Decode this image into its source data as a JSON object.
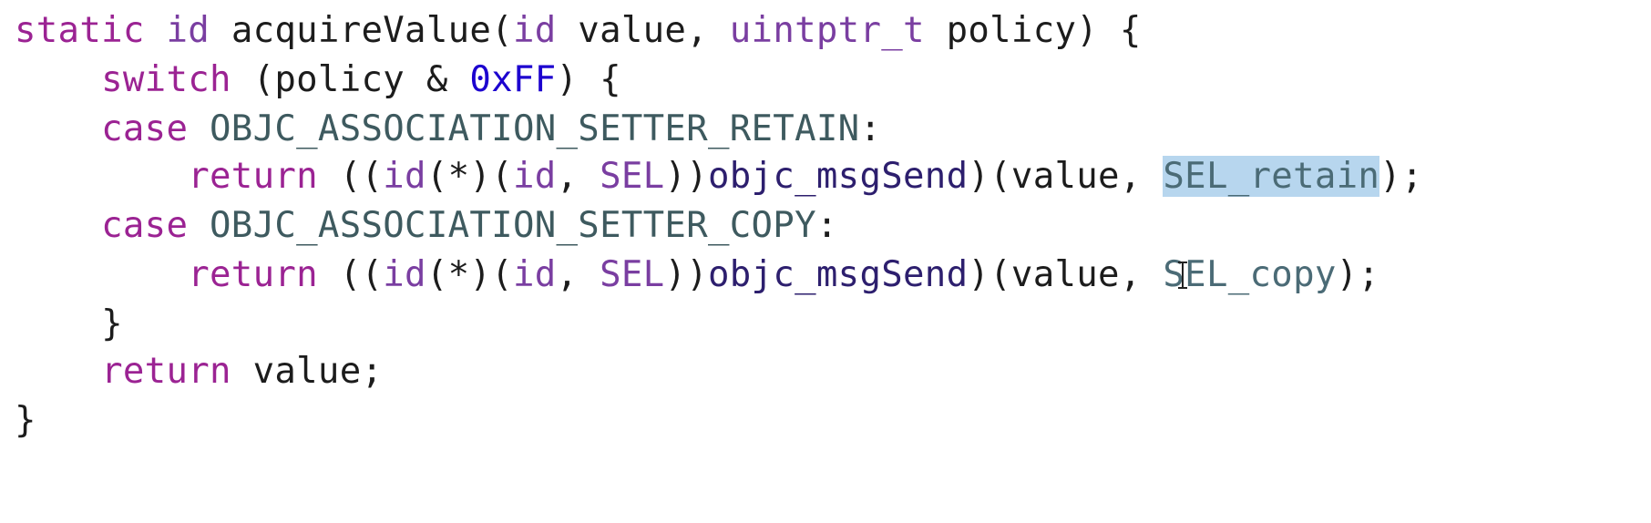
{
  "code": {
    "line1": {
      "kw_static": "static",
      "t_id": "id",
      "name": "acquireValue(",
      "t_id2": "id",
      "p1": "value,",
      "t_uintptr": "uintptr_t",
      "p2": "policy) {"
    },
    "line2": {
      "kw_switch": "switch",
      "open": "(policy &",
      "hex": "0xFF",
      "close": ") {"
    },
    "line3": {
      "kw_case": "case",
      "macro": "OBJC_ASSOCIATION_SETTER_RETAIN",
      "colon": ":"
    },
    "line4": {
      "kw_return": "return",
      "a": "((",
      "t_id": "id",
      "b": "(*)(",
      "t_id2": "id",
      "c": ",",
      "t_sel": "SEL",
      "d": "))",
      "fn": "objc_msgSend",
      "e": ")(value,",
      "sel": "SEL_retain",
      "f": ");"
    },
    "line5": {
      "kw_case": "case",
      "macro": "OBJC_ASSOCIATION_SETTER_COPY",
      "colon": ":"
    },
    "line6": {
      "kw_return": "return",
      "a": "((",
      "t_id": "id",
      "b": "(*)(",
      "t_id2": "id",
      "c": ",",
      "t_sel": "SEL",
      "d": "))",
      "fn": "objc_msgSend",
      "e": ")(value,",
      "sel": "SEL_copy",
      "f": ");"
    },
    "line7": {
      "brace": "}"
    },
    "line8": {
      "kw_return": "return",
      "rest": "value;"
    },
    "line9": {
      "brace": "}"
    }
  },
  "colors": {
    "keyword": "#9b2393",
    "type": "#7a3ea1",
    "number": "#1c00cf",
    "macro": "#3e5a5f",
    "function": "#2d1f6e",
    "selection_highlight": "#b7d6ee"
  },
  "icons": {
    "cursor": "text-ibeam-cursor-icon"
  }
}
